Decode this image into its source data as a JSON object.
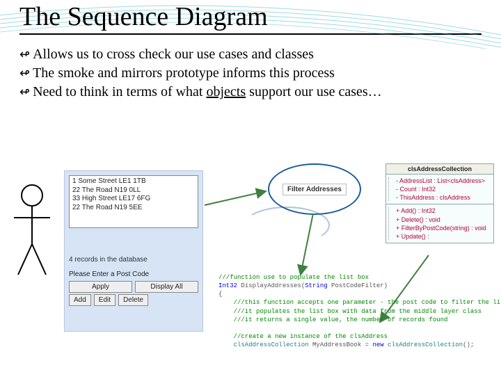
{
  "title": "The Sequence Diagram",
  "bullets": [
    "Allows us to cross check our use cases and classes",
    "The smoke and mirrors prototype informs this process",
    "Need to think in terms of what <u>objects</u> support our use cases…"
  ],
  "form": {
    "rows": "1 Some Street LE1 1TB\n22 The Road N19 0LL\n33 High Street LE17 6FG\n22 The Road N19 5EE",
    "status": "4 records in the database",
    "prompt": "Please Enter a Post Code",
    "buttons_top": [
      "Apply",
      "Display All"
    ],
    "buttons_bottom": [
      "Add",
      "Edit",
      "Delete"
    ]
  },
  "usecase": {
    "label": "Filter Addresses"
  },
  "classbox": {
    "name": "clsAddressCollection",
    "attrs": "-  AddressList : List<clsAddress>\n-  Count : Int32\n-  ThisAddress : clsAddress",
    "ops": "+  Add() : Int32\n+  Delete() : void\n+  FilterByPostCode(string) : void\n+  Update() :"
  },
  "code": {
    "c1": "///function use to populate the list box",
    "l2a": "Int32",
    "l2b": " DisplayAddresses(",
    "l2c": "String",
    "l2d": " PostCodeFilter)",
    "l3": "{",
    "c4": "    ///this function accepts one parameter - the post code to filter the list on",
    "c5": "    ///it populates the list box with data from the middle layer class",
    "c6": "    ///it returns a single value, the number of records found",
    "c7": "",
    "c8": "    //create a new instance of the clsAddress",
    "l9a": "    clsAddressCollection",
    "l9b": " MyAddressBook = ",
    "l9c": "new",
    "l9d": " clsAddressCollection",
    "l9e": "();"
  }
}
